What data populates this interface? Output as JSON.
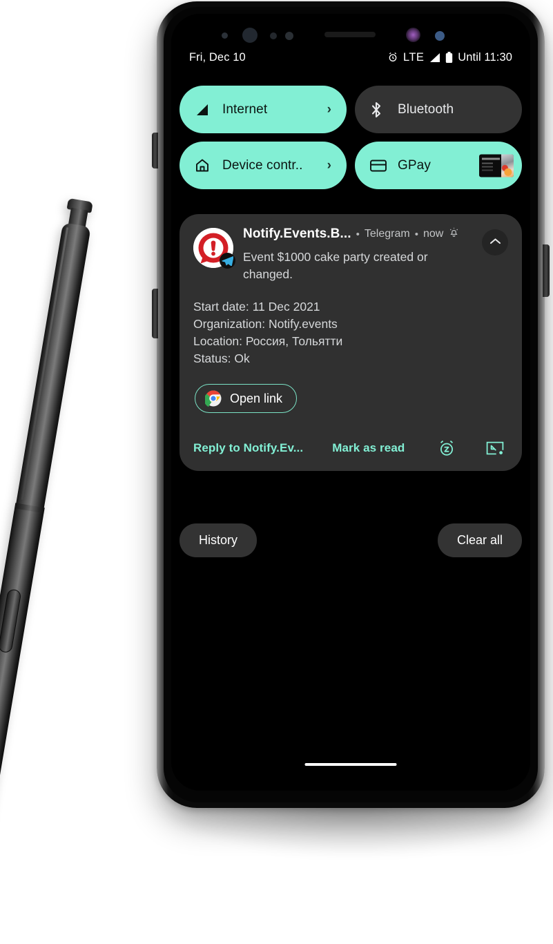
{
  "device": {
    "name": "Samsung Galaxy Note with S Pen stylus",
    "stylus": "s-pen-stylus"
  },
  "status_bar": {
    "date": "Fri, Dec 10",
    "alarm_icon": "alarm-clock-icon",
    "network": "LTE",
    "signal_icon": "signal-bars-icon",
    "battery_icon": "battery-icon",
    "battery_text": "Until 11:30"
  },
  "quick_settings": {
    "tiles": [
      {
        "id": "internet",
        "label": "Internet",
        "icon": "signal-wifi-icon",
        "state": "on",
        "chevron": "›",
        "accessory": "chevron"
      },
      {
        "id": "bluetooth",
        "label": "Bluetooth",
        "icon": "bluetooth-icon",
        "state": "off",
        "chevron": "",
        "accessory": "none"
      },
      {
        "id": "device-controls",
        "label": "Device contr..",
        "icon": "home-icon",
        "state": "on",
        "chevron": "›",
        "accessory": "chevron"
      },
      {
        "id": "gpay",
        "label": "GPay",
        "icon": "credit-card-icon",
        "state": "on",
        "chevron": "",
        "accessory": "card-thumbnail"
      }
    ]
  },
  "notification": {
    "app_icon": "notify-events-logo",
    "badge_icon": "telegram-icon",
    "app_name": "Notify.Events.B...",
    "separator": "•",
    "source": "Telegram",
    "time": "now",
    "silent_icon": "bell-silent-icon",
    "collapse_icon": "chevron-up-icon",
    "body": "Event $1000 cake party created or changed.",
    "details": [
      "Start date: 11 Dec 2021",
      "Organization: Notify.events",
      "Location: Россия, Тольятти",
      "Status: Ok"
    ],
    "open_link_button": {
      "label": "Open link",
      "icon": "chrome-icon"
    },
    "actions": {
      "reply": "Reply to Notify.Ev...",
      "mark_read": "Mark as read",
      "snooze_icon": "snooze-alarm-icon",
      "bubble_icon": "bubble-minimize-icon"
    }
  },
  "shade_controls": {
    "history": "History",
    "clear_all": "Clear all"
  },
  "colors": {
    "accent_mint": "#82efd4",
    "tile_off": "#333333",
    "panel": "#303030",
    "screen_bg": "#000000",
    "text_primary": "#ffffff",
    "text_secondary": "#d6d8da"
  }
}
